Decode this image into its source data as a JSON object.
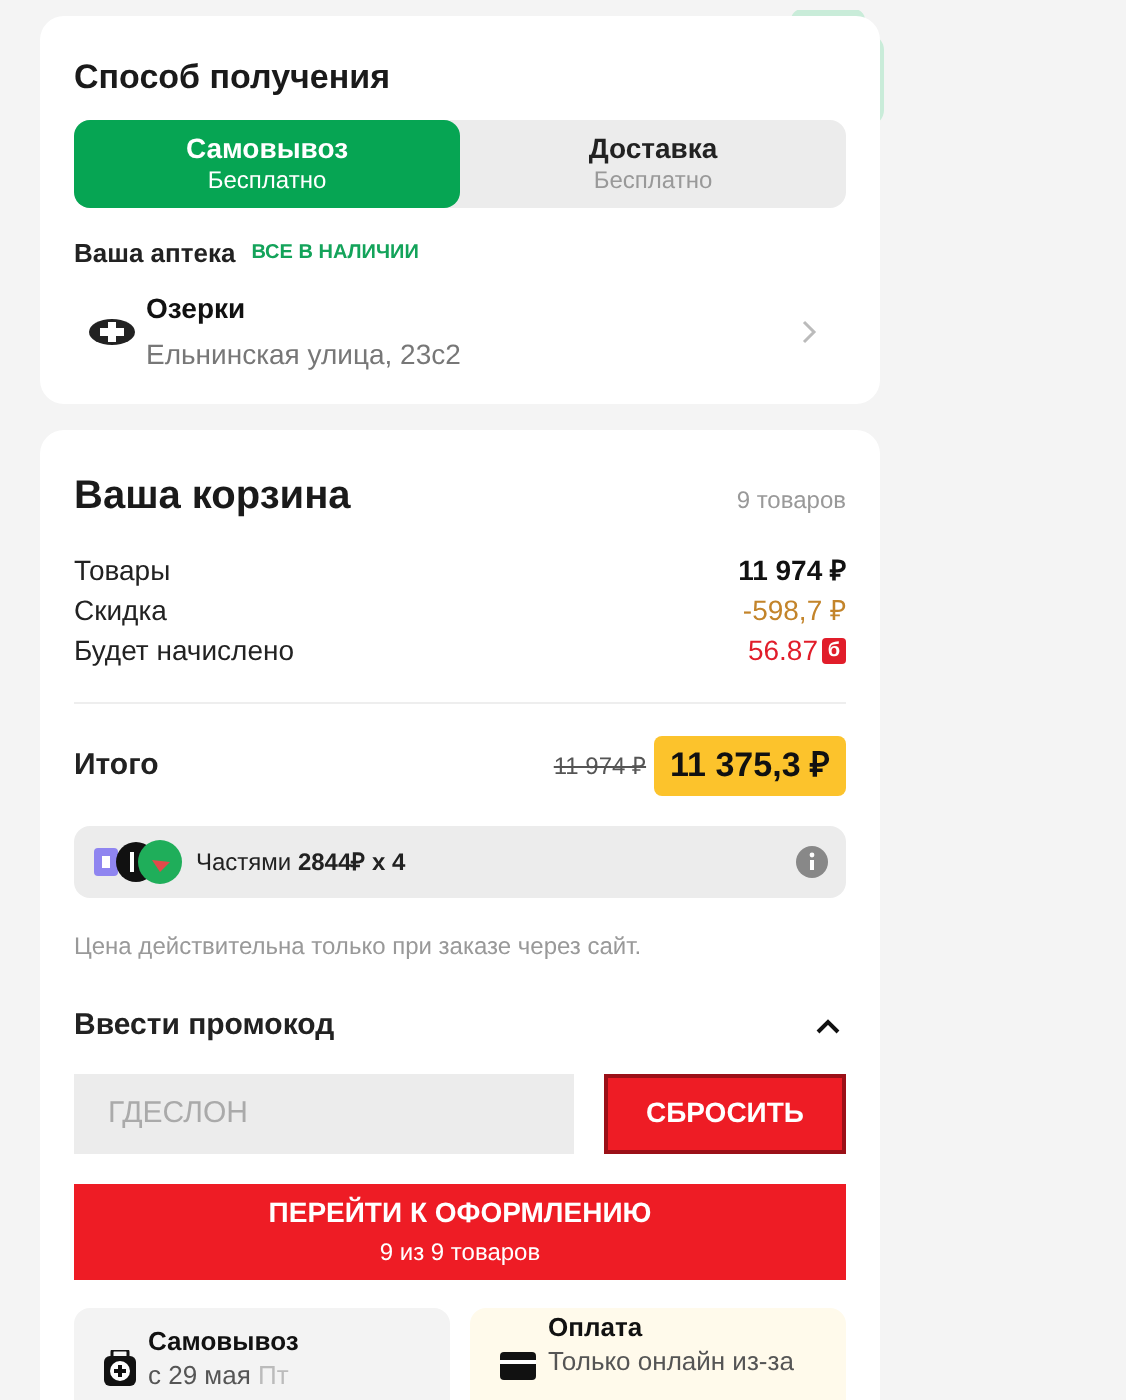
{
  "delivery": {
    "title": "Способ получения",
    "tabs": [
      {
        "label": "Самовывоз",
        "note": "Бесплатно",
        "selected": true
      },
      {
        "label": "Доставка",
        "note": "Бесплатно",
        "selected": false
      }
    ],
    "pharmacy_label": "Ваша аптека",
    "availability": "ВСЕ В НАЛИЧИИ",
    "pharmacy": {
      "name": "Озерки",
      "address": "Ельнинская улица, 23с2"
    }
  },
  "cart": {
    "title": "Ваша корзина",
    "count": "9 товаров",
    "lines": [
      {
        "label": "Товары",
        "value": "11 974 ₽",
        "kind": "plain"
      },
      {
        "label": "Скидка",
        "value": "-598,7 ₽",
        "kind": "discount"
      },
      {
        "label": "Будет начислено",
        "value": "56.87",
        "badge": "б",
        "kind": "bonus"
      }
    ],
    "total_label": "Итого",
    "old_total": "11 974 ₽",
    "total": "11 375,3 ₽",
    "installments": {
      "label": "Частями",
      "amount": "2844₽ x 4"
    },
    "note": "Цена действительна только при заказе через сайт.",
    "promo": {
      "title": "Ввести промокод",
      "expanded": true,
      "placeholder": "ГДЕСЛОН",
      "reset": "СБРОСИТЬ"
    },
    "checkout": {
      "label": "ПЕРЕЙТИ К ОФОРМЛЕНИЮ",
      "sub": "9 из 9 товаров"
    },
    "info_cards": [
      {
        "kind": "pickup",
        "title": "Самовывоз",
        "text": "с 29 мая",
        "extra": "Пт"
      },
      {
        "kind": "payment",
        "title": "Оплата",
        "text": "Только онлайн из-за"
      }
    ]
  }
}
